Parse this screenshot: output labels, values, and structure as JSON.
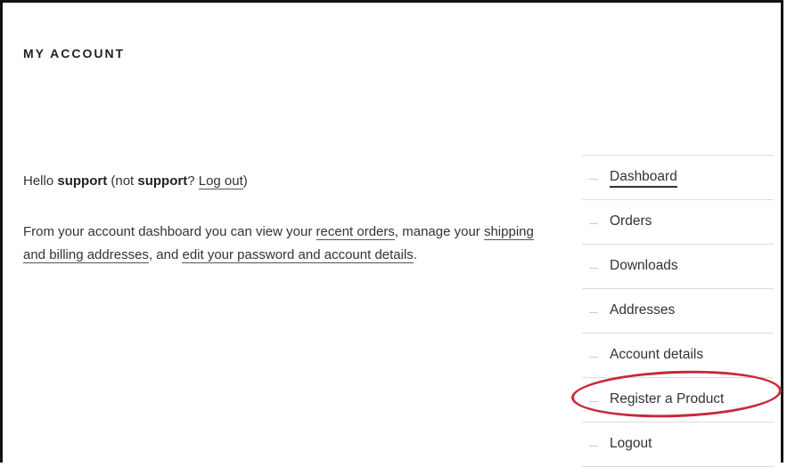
{
  "title": "MY ACCOUNT",
  "greeting": {
    "hello": "Hello",
    "username": "support",
    "not_prefix": "(not",
    "not_username": "support",
    "question": "?",
    "logout_link": "Log out",
    "close_paren": ")"
  },
  "intro": {
    "part1": "From your account dashboard you can view your",
    "link_orders": "recent orders",
    "part2": ", manage your",
    "link_addresses": "shipping and billing addresses",
    "part3": ", and",
    "link_account": "edit your password and account details",
    "part4": "."
  },
  "nav": {
    "items": [
      {
        "label": "Dashboard"
      },
      {
        "label": "Orders"
      },
      {
        "label": "Downloads"
      },
      {
        "label": "Addresses"
      },
      {
        "label": "Account details"
      },
      {
        "label": "Register a Product"
      },
      {
        "label": "Logout"
      }
    ],
    "active_index": 0,
    "highlighted_index": 5
  },
  "colors": {
    "highlight_ring": "#c8283a",
    "text": "#333333"
  }
}
